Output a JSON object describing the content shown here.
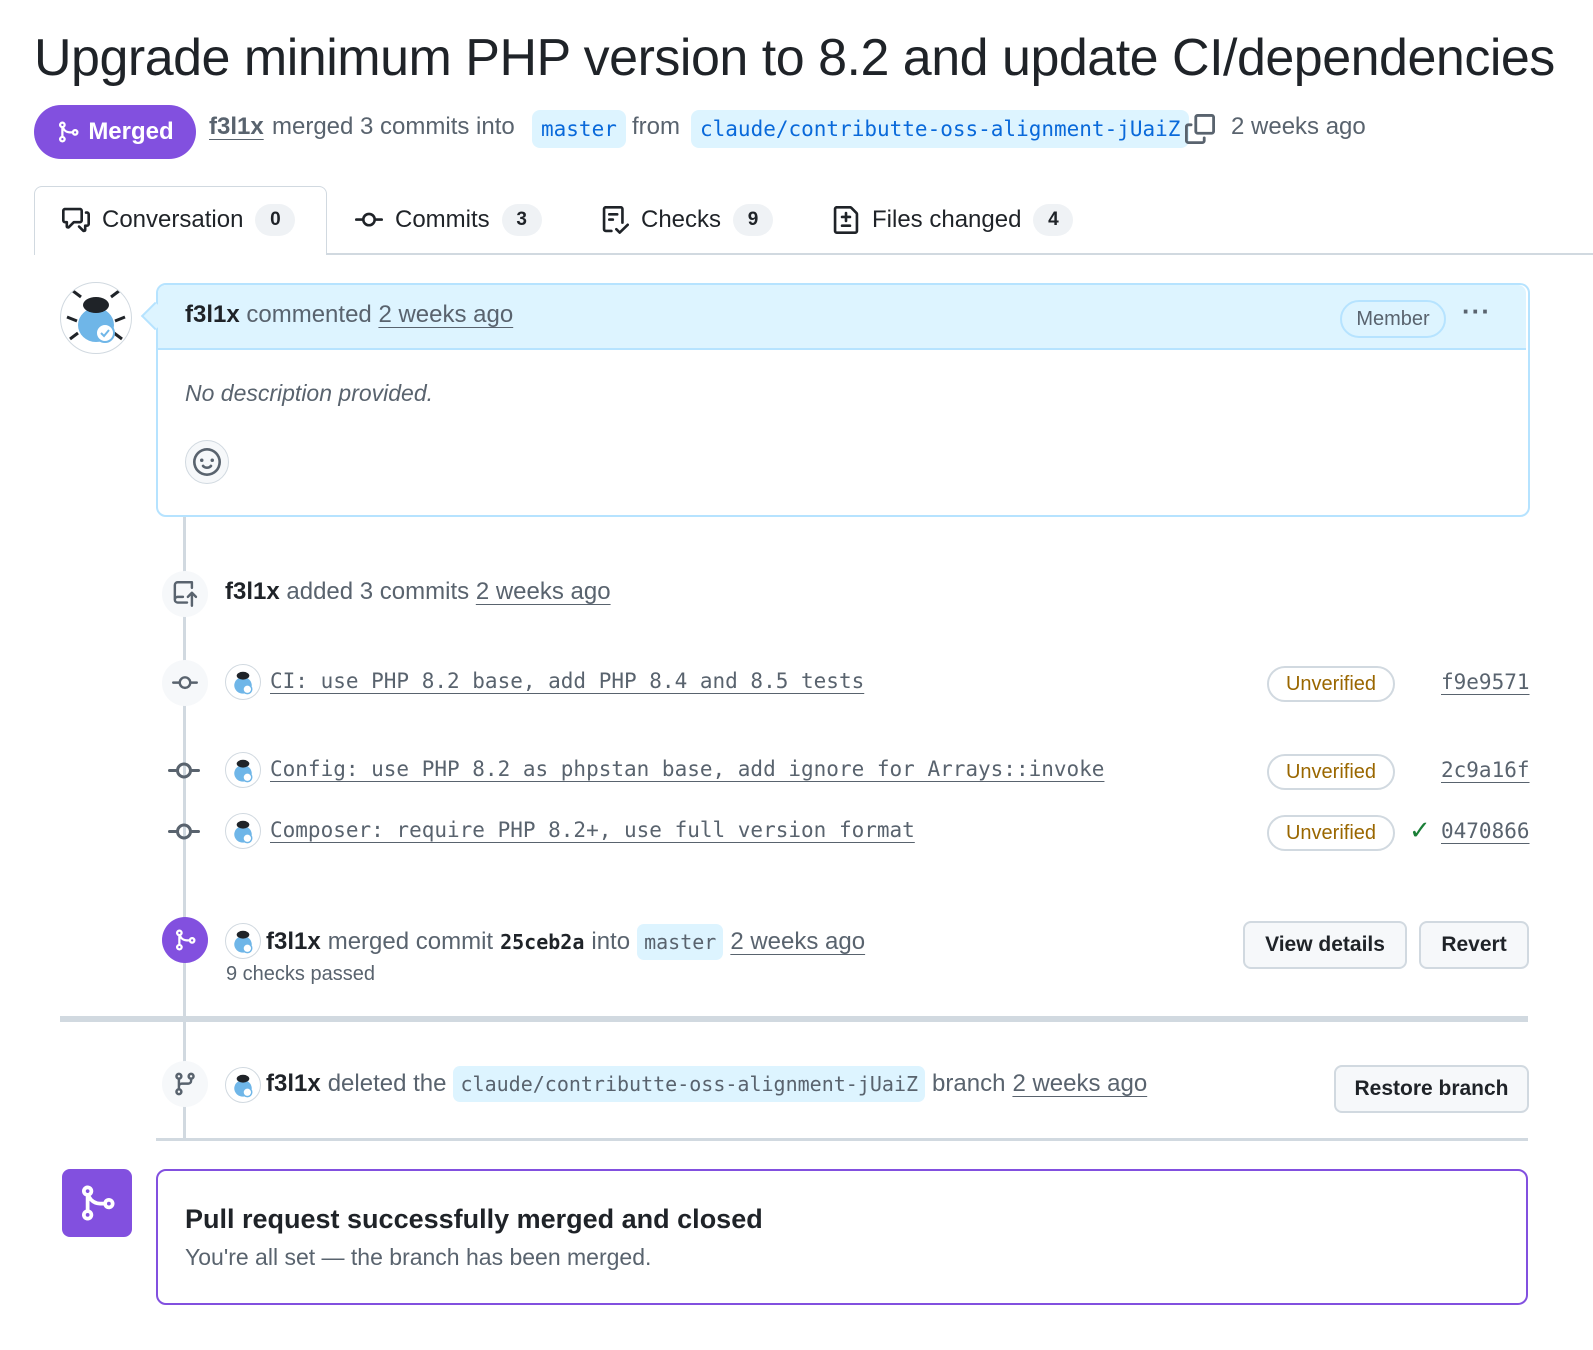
{
  "title": "Upgrade minimum PHP version to 8.2 and update CI/dependencies",
  "header": {
    "status_badge": "Merged",
    "author": "f3l1x",
    "merged_text": "merged 3 commits into",
    "base_branch": "master",
    "from_text": "from",
    "head_branch": "claude/contributte-oss-alignment-jUaiZ",
    "time": "2 weeks ago"
  },
  "tabs": [
    {
      "label": "Conversation",
      "count": "0",
      "icon": "comment-discussion-icon"
    },
    {
      "label": "Commits",
      "count": "3",
      "icon": "git-commit-icon"
    },
    {
      "label": "Checks",
      "count": "9",
      "icon": "checklist-icon"
    },
    {
      "label": "Files changed",
      "count": "4",
      "icon": "file-diff-icon"
    }
  ],
  "comment": {
    "author": "f3l1x",
    "action": "commented",
    "time": "2 weeks ago",
    "role_badge": "Member",
    "more": "···",
    "body": "No description provided."
  },
  "commits_event": {
    "author": "f3l1x",
    "action": "added 3 commits",
    "time": "2 weeks ago"
  },
  "commits": [
    {
      "message": "CI: use PHP 8.2 base, add PHP 8.4 and 8.5 tests",
      "badge": "Unverified",
      "sha": "f9e9571",
      "check": ""
    },
    {
      "message": "Config: use PHP 8.2 as phpstan base, add ignore for Arrays::invoke",
      "badge": "Unverified",
      "sha": "2c9a16f",
      "check": ""
    },
    {
      "message": "Composer: require PHP 8.2+, use full version format",
      "badge": "Unverified",
      "sha": "0470866",
      "check": "✓"
    }
  ],
  "merge_event": {
    "author": "f3l1x",
    "action": "merged commit",
    "commit": "25ceb2a",
    "into": "into",
    "branch": "master",
    "time": "2 weeks ago",
    "checks": "9 checks passed",
    "view_details": "View details",
    "revert": "Revert"
  },
  "delete_event": {
    "author": "f3l1x",
    "action": "deleted the",
    "branch": "claude/contributte-oss-alignment-jUaiZ",
    "suffix": "branch",
    "time": "2 weeks ago",
    "restore": "Restore branch"
  },
  "merged_footer": {
    "title": "Pull request successfully merged and closed",
    "subtitle": "You're all set — the branch has been merged."
  },
  "colors": {
    "merged_purple": "#8250df",
    "link_blue": "#0969da",
    "branch_bg": "#ddf4ff",
    "unverified": "#9a6700",
    "success": "#1a7f37"
  }
}
